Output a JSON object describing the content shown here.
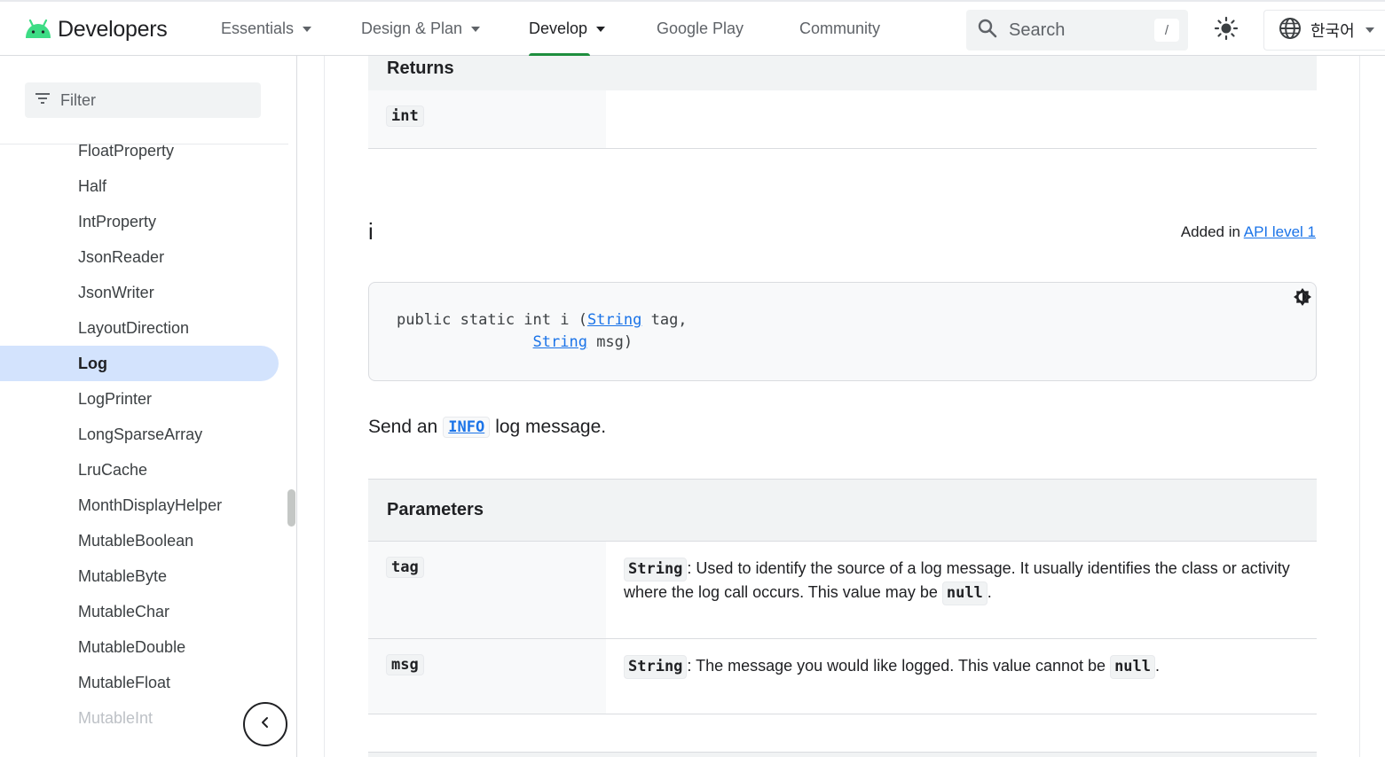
{
  "header": {
    "logo_text": "Developers",
    "nav": [
      {
        "label": "Essentials",
        "has_menu": true
      },
      {
        "label": "Design & Plan",
        "has_menu": true
      },
      {
        "label": "Develop",
        "has_menu": true,
        "active": true
      },
      {
        "label": "Google Play",
        "has_menu": false
      },
      {
        "label": "Community",
        "has_menu": false
      }
    ],
    "search_placeholder": "Search",
    "search_shortcut": "/",
    "language": "한국어"
  },
  "sidebar": {
    "filter_placeholder": "Filter",
    "items": [
      "FloatProperty",
      "Half",
      "IntProperty",
      "JsonReader",
      "JsonWriter",
      "LayoutDirection",
      "Log",
      "LogPrinter",
      "LongSparseArray",
      "LruCache",
      "MonthDisplayHelper",
      "MutableBoolean",
      "MutableByte",
      "MutableChar",
      "MutableDouble",
      "MutableFloat",
      "MutableInt"
    ],
    "active_item": "Log"
  },
  "main": {
    "returns_table": {
      "heading": "Returns",
      "type": "int"
    },
    "method": {
      "name": "i",
      "added_in_prefix": "Added in ",
      "added_in_link": "API level 1",
      "signature": {
        "line1_prefix": "public static int i (",
        "param1_type": "String",
        "param1_name": " tag,",
        "param2_type": "String",
        "param2_name": " msg)"
      },
      "summary_before": "Send an",
      "summary_code": "INFO",
      "summary_after": "log message."
    },
    "parameters_table": {
      "heading": "Parameters",
      "rows": [
        {
          "name": "tag",
          "type": "String",
          "text": ": Used to identify the source of a log message. It usually identifies the class or activity where the log call occurs. This value may be ",
          "nullity": "null",
          "end": "."
        },
        {
          "name": "msg",
          "type": "String",
          "text": ": The message you would like logged. This value cannot be ",
          "nullity": "null",
          "end": "."
        }
      ]
    }
  },
  "colors": {
    "accent": "#1a73e8",
    "active_nav_underline": "#1e8e3e",
    "active_sidebar_bg": "#d3e3fd",
    "android_green": "#3ddc84"
  },
  "icons": [
    "android-logo-icon",
    "search-icon",
    "theme-toggle-icon",
    "globe-icon",
    "filter-icon",
    "chevron-left-icon",
    "code-theme-icon"
  ]
}
